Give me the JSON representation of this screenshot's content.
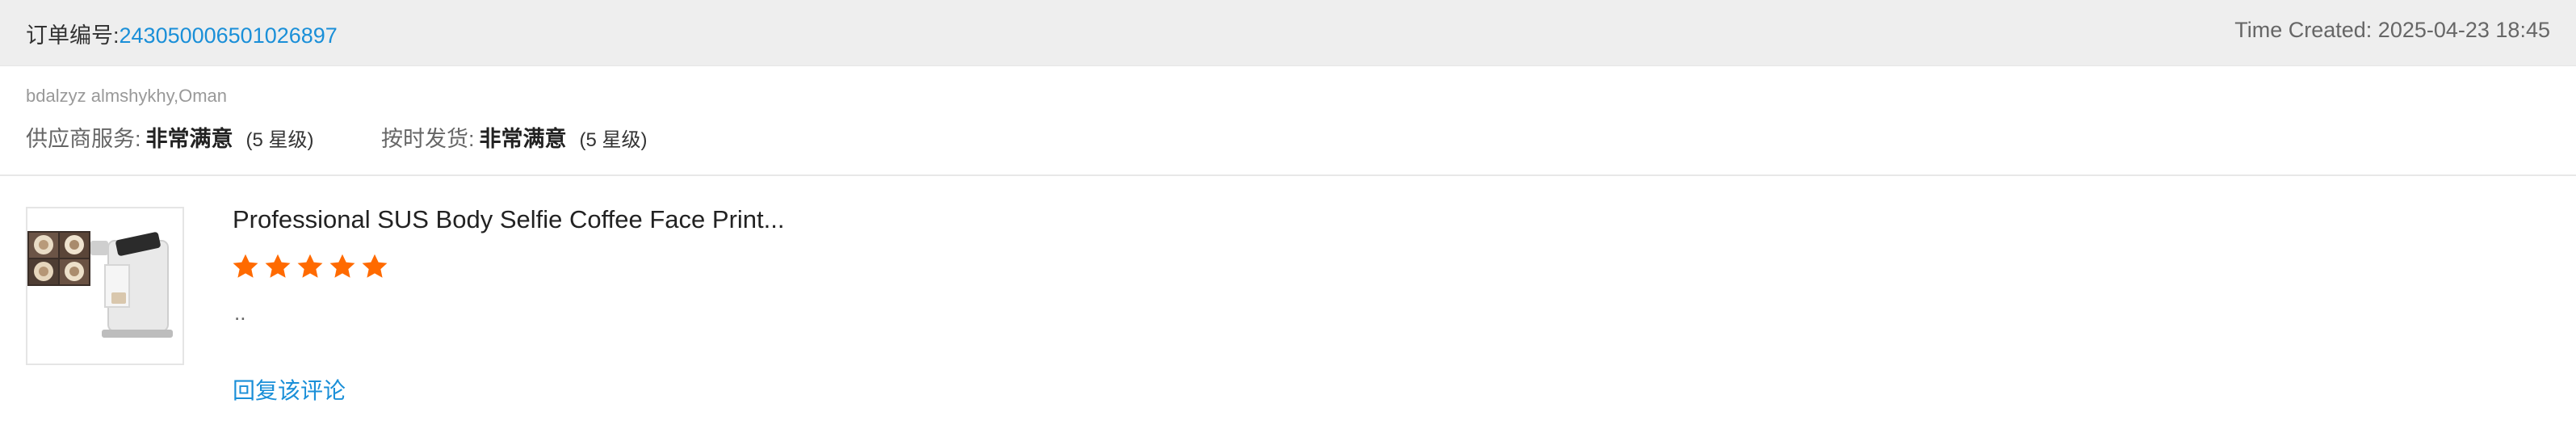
{
  "order": {
    "label": "订单编号:",
    "number": "243050006501026897",
    "time_created": "Time Created: 2025-04-23 18:45"
  },
  "buyer": {
    "name_location": "bdalzyz almshykhy,Oman"
  },
  "ratings": [
    {
      "label": "供应商服务:",
      "value": "非常满意",
      "level": "(5 星级)"
    },
    {
      "label": "按时发货:",
      "value": "非常满意",
      "level": "(5 星级)"
    }
  ],
  "product": {
    "title": "Professional SUS Body Selfie Coffee Face Print...",
    "thumbnail_icon": "coffee-printer-product-image",
    "stars": 5,
    "star_color": "#ff6a00",
    "comment": ".."
  },
  "actions": {
    "reply_label": "回复该评论"
  },
  "colors": {
    "link": "#1a8fd8",
    "header_bg": "#eeeeee"
  }
}
